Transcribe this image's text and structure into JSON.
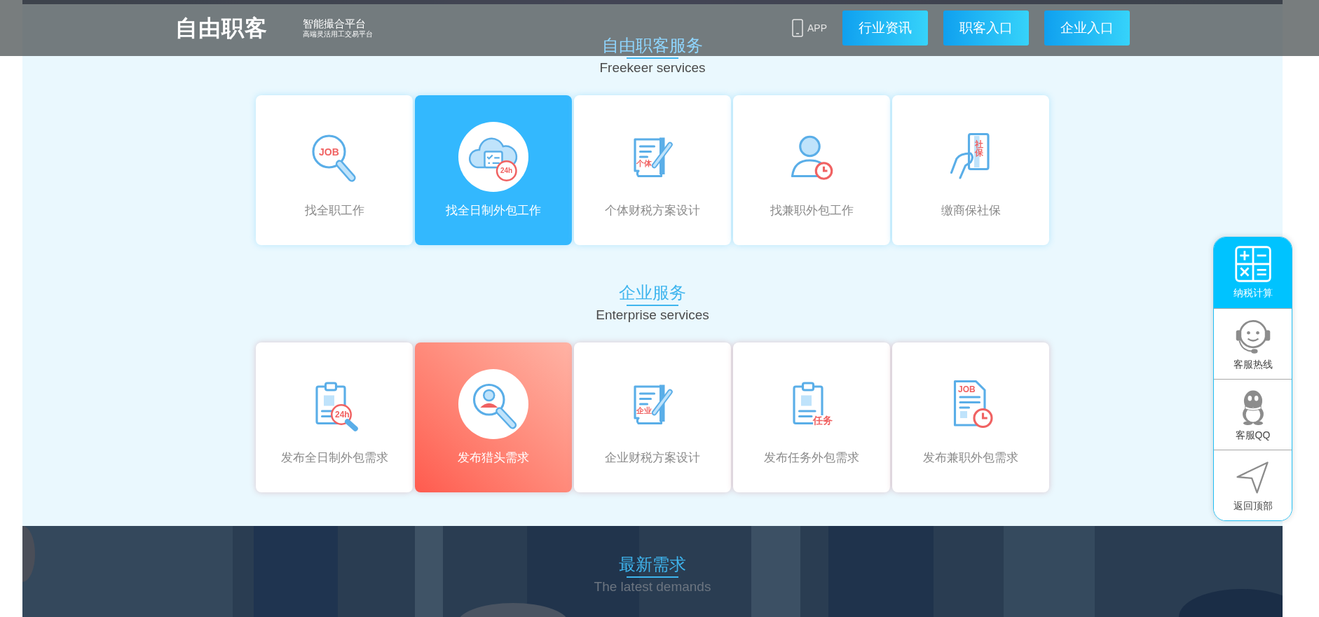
{
  "header": {
    "logo": "自由职客",
    "tagline": "智能撮合平台",
    "tagline_sub": "高端灵活用工交易平台",
    "app_label": "APP",
    "nav_buttons": [
      "行业资讯",
      "职客入口",
      "企业入口"
    ]
  },
  "sections": [
    {
      "kind": "blue",
      "title": "自由职客服务",
      "subtitle": "Freekeer services",
      "cards": [
        {
          "label": "找全职工作",
          "badge": "JOB",
          "selected": false
        },
        {
          "label": "找全日制外包工作",
          "badge": "24h",
          "selected": true
        },
        {
          "label": "个体财税方案设计",
          "badge": "个体",
          "selected": false
        },
        {
          "label": "找兼职外包工作",
          "selected": false
        },
        {
          "label": "缴商保社保",
          "badge": "社保",
          "selected": false
        }
      ]
    },
    {
      "kind": "red",
      "title": "企业服务",
      "subtitle": "Enterprise services",
      "cards": [
        {
          "label": "发布全日制外包需求",
          "badge": "24h",
          "selected": false
        },
        {
          "label": "发布猎头需求",
          "selected": true
        },
        {
          "label": "企业财税方案设计",
          "badge": "企业",
          "selected": false
        },
        {
          "label": "发布任务外包需求",
          "badge": "任务",
          "selected": false
        },
        {
          "label": "发布兼职外包需求",
          "badge": "JOB",
          "selected": false
        }
      ]
    }
  ],
  "latest": {
    "title": "最新需求",
    "subtitle": "The latest demands"
  },
  "sidebar": [
    {
      "label": "纳税计算",
      "selected": true
    },
    {
      "label": "客服热线",
      "selected": false
    },
    {
      "label": "客服QQ",
      "selected": false
    },
    {
      "label": "返回顶部",
      "selected": false
    }
  ]
}
